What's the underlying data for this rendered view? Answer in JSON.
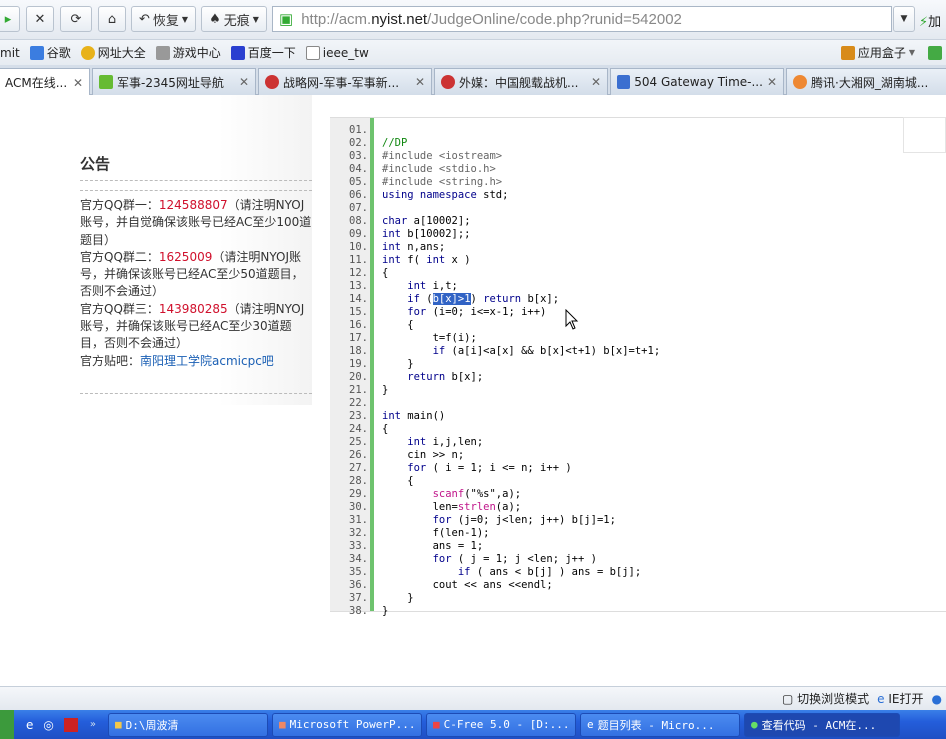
{
  "toolbar": {
    "restore": "恢复",
    "incognito": "无痕",
    "url_pre": "http://acm.",
    "url_host": "nyist.net",
    "url_path": "/JudgeOnline/code.php?runid=542002",
    "speed": "加"
  },
  "bookmarks": {
    "items": [
      "mit",
      "谷歌",
      "网址大全",
      "游戏中心",
      "百度一下",
      "ieee_tw"
    ],
    "appbox": "应用盒子"
  },
  "tabs": [
    {
      "label": "ACM在线...",
      "active": true
    },
    {
      "label": "军事-2345网址导航"
    },
    {
      "label": "战略网-军事-军事新..."
    },
    {
      "label": "外媒：中国舰载战机..."
    },
    {
      "label": "504 Gateway Time-..."
    },
    {
      "label": "腾讯·大湘网_湖南城..."
    }
  ],
  "notice": {
    "title": "公告",
    "g1_label": "官方QQ群一：",
    "g1_num": "124588807",
    "g1_text": "（请注明NYOJ账号，并自觉确保该账号已经AC至少100道题目）",
    "g2_label": "官方QQ群二：",
    "g2_num": "1625009",
    "g2_text": "（请注明NYOJ账号，并确保该账号已经AC至少50道题目，否则不会通过）",
    "g3_label": "官方QQ群三：",
    "g3_num": "143980285",
    "g3_text": "（请注明NYOJ账号，并确保该账号已经AC至少30道题目，否则不会通过）",
    "tieba_label": "官方贴吧：",
    "tieba_link": "南阳理工学院acmicpc吧"
  },
  "code_lines": [
    [],
    [
      [
        "//DP",
        "cm"
      ]
    ],
    [
      [
        "#include <iostream>",
        "pp"
      ]
    ],
    [
      [
        "#include <stdio.h>",
        "pp"
      ]
    ],
    [
      [
        "#include <string.h>",
        "pp"
      ]
    ],
    [
      [
        "using namespace",
        "kw"
      ],
      [
        " std;",
        ""
      ]
    ],
    [],
    [
      [
        "char",
        "kw"
      ],
      [
        " a[10002];",
        ""
      ]
    ],
    [
      [
        "int",
        "kw"
      ],
      [
        " b[10002];;",
        ""
      ]
    ],
    [
      [
        "int",
        "kw"
      ],
      [
        " n,ans;",
        ""
      ]
    ],
    [
      [
        "int",
        "kw"
      ],
      [
        " f( ",
        ""
      ],
      [
        "int",
        "kw"
      ],
      [
        " x )",
        ""
      ]
    ],
    [
      [
        "{",
        ""
      ]
    ],
    [
      [
        "    int",
        "kw"
      ],
      [
        " i,t;",
        ""
      ]
    ],
    [
      [
        "    if",
        "kw"
      ],
      [
        " (",
        ""
      ],
      [
        "b[x]>1",
        "sel"
      ],
      [
        ") ",
        ""
      ],
      [
        "return",
        "kw"
      ],
      [
        " b[x];",
        ""
      ]
    ],
    [
      [
        "    for",
        "kw"
      ],
      [
        " (i=0; i<=x-1; i++)",
        ""
      ]
    ],
    [
      [
        "    {",
        ""
      ]
    ],
    [
      [
        "        t=f(i);",
        ""
      ]
    ],
    [
      [
        "        if",
        "kw"
      ],
      [
        " (a[i]<a[x] && b[x]<t+1) b[x]=t+1;",
        ""
      ]
    ],
    [
      [
        "    }",
        ""
      ]
    ],
    [
      [
        "    return",
        "kw"
      ],
      [
        " b[x];",
        ""
      ]
    ],
    [
      [
        "}",
        ""
      ]
    ],
    [],
    [
      [
        "int",
        "kw"
      ],
      [
        " main()",
        ""
      ]
    ],
    [
      [
        "{",
        ""
      ]
    ],
    [
      [
        "    int",
        "kw"
      ],
      [
        " i,j,len;",
        ""
      ]
    ],
    [
      [
        "    cin >> n;",
        ""
      ]
    ],
    [
      [
        "    for",
        "kw"
      ],
      [
        " ( i = 1; i <= n; i++ )",
        ""
      ]
    ],
    [
      [
        "    {",
        ""
      ]
    ],
    [
      [
        "        ",
        ""
      ],
      [
        "scanf",
        "fn"
      ],
      [
        "(\"%s\",a);",
        ""
      ]
    ],
    [
      [
        "        len=",
        ""
      ],
      [
        "strlen",
        "fn"
      ],
      [
        "(a);",
        ""
      ]
    ],
    [
      [
        "        for",
        "kw"
      ],
      [
        " (j=0; j<len; j++) b[j]=1;",
        ""
      ]
    ],
    [
      [
        "        f(len-1);",
        ""
      ]
    ],
    [
      [
        "        ans = 1;",
        ""
      ]
    ],
    [
      [
        "        for",
        "kw"
      ],
      [
        " ( j = 1; j <len; j++ )",
        ""
      ]
    ],
    [
      [
        "            if",
        "kw"
      ],
      [
        " ( ans < b[j] ) ans = b[j];",
        ""
      ]
    ],
    [
      [
        "        cout << ans <<endl;",
        ""
      ]
    ],
    [
      [
        "    }",
        ""
      ]
    ],
    [
      [
        "}",
        ""
      ]
    ]
  ],
  "status": {
    "switch_mode": "切换浏览模式",
    "ie_open": "IE打开"
  },
  "taskbar": [
    "D:\\周波清",
    "Microsoft PowerP...",
    "C-Free 5.0 - [D:...",
    "题目列表 - Micro...",
    "查看代码 - ACM在..."
  ],
  "colors": {
    "accent_red": "#d0102c",
    "link_blue": "#1a5fb4",
    "gutter_green": "#6ec36e"
  }
}
